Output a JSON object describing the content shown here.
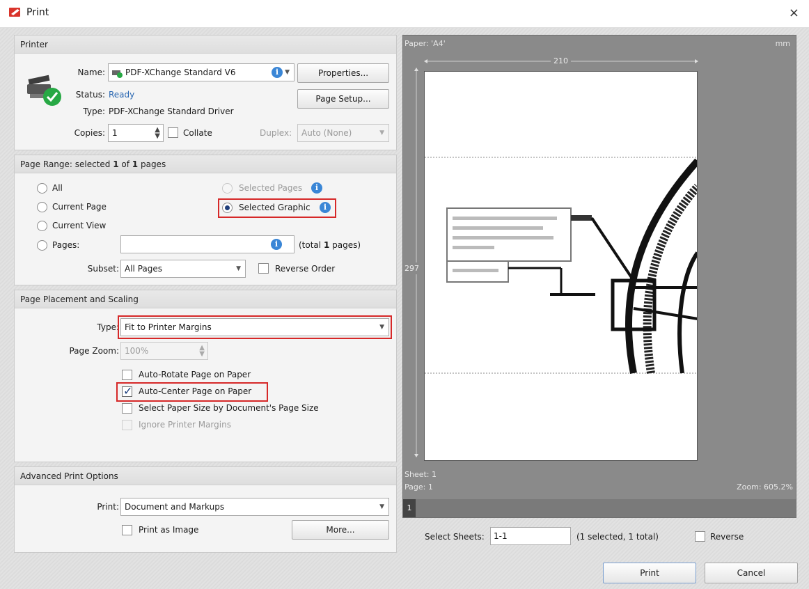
{
  "window": {
    "title": "Print",
    "close_glyph": "×",
    "icon": "print-app-icon"
  },
  "printer": {
    "group_title": "Printer",
    "name_label": "Name:",
    "name_value": "PDF-XChange Standard V6",
    "status_label": "Status:",
    "status_value": "Ready",
    "type_label": "Type:",
    "type_value": "PDF-XChange Standard Driver",
    "copies_label": "Copies:",
    "copies_value": "1",
    "collate_label": "Collate",
    "duplex_label": "Duplex:",
    "duplex_value": "Auto (None)",
    "properties_button": "Properties...",
    "page_setup_button": "Page Setup..."
  },
  "page_range": {
    "group_title_prefix": "Page Range: selected ",
    "selected_count": "1",
    "group_title_mid": " of ",
    "total_count": "1",
    "group_title_suffix": " pages",
    "all_label": "All",
    "current_page_label": "Current Page",
    "current_view_label": "Current View",
    "pages_label": "Pages:",
    "pages_value": "",
    "total_prefix": "(total ",
    "total_pages": "1",
    "total_suffix": " pages)",
    "selected_pages_label": "Selected Pages",
    "selected_graphic_label": "Selected Graphic",
    "selected_option": "Selected Graphic",
    "subset_label": "Subset:",
    "subset_value": "All Pages",
    "reverse_order_label": "Reverse Order"
  },
  "placement": {
    "group_title": "Page Placement and Scaling",
    "type_label": "Type:",
    "type_value": "Fit to Printer Margins",
    "zoom_label": "Page Zoom:",
    "zoom_value": "100%",
    "auto_rotate_label": "Auto-Rotate Page on Paper",
    "auto_rotate_checked": false,
    "auto_center_label": "Auto-Center Page on Paper",
    "auto_center_checked": true,
    "select_paper_label": "Select Paper Size by Document's Page Size",
    "select_paper_checked": false,
    "ignore_margins_label": "Ignore Printer Margins",
    "ignore_margins_checked": false
  },
  "advanced": {
    "group_title": "Advanced Print Options",
    "print_label": "Print:",
    "print_value": "Document and Markups",
    "print_as_image_label": "Print as Image",
    "more_button": "More..."
  },
  "preview": {
    "paper_label": "Paper: 'A4'",
    "units": "mm",
    "width_mm": "210",
    "height_mm": "297",
    "sheet_label": "Sheet: 1",
    "page_label": "Page: 1",
    "zoom_label": "Zoom: 605.2%",
    "thumb_number": "1",
    "select_sheets_label": "Select Sheets:",
    "select_sheets_value": "1-1",
    "selection_summary": "(1 selected, 1 total)",
    "reverse_label": "Reverse"
  },
  "footer": {
    "print_button": "Print",
    "cancel_button": "Cancel"
  },
  "colors": {
    "accent_blue": "#2a67b1",
    "highlight_red": "#d62828",
    "info_blue": "#3a86d6",
    "status_green": "#27a844"
  }
}
